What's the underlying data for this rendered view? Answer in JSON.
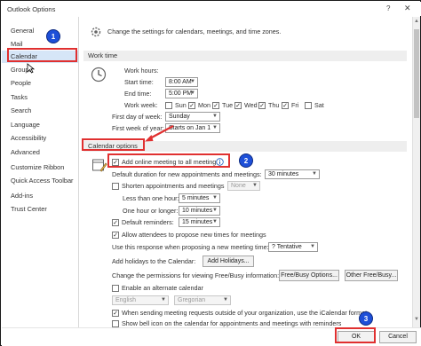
{
  "window": {
    "title": "Outlook Options",
    "help_glyph": "?",
    "close_glyph": "✕"
  },
  "sidebar": {
    "items": [
      {
        "label": "General"
      },
      {
        "label": "Mail"
      },
      {
        "label": "Calendar"
      },
      {
        "label": "Groups"
      },
      {
        "label": "People"
      },
      {
        "label": "Tasks"
      },
      {
        "label": "Search"
      },
      {
        "label": "Language"
      },
      {
        "label": "Accessibility"
      },
      {
        "label": "Advanced"
      },
      {
        "label": "Customize Ribbon"
      },
      {
        "label": "Quick Access Toolbar"
      },
      {
        "label": "Add-ins"
      },
      {
        "label": "Trust Center"
      }
    ],
    "selected": "Calendar"
  },
  "header": {
    "text": "Change the settings for calendars, meetings, and time zones."
  },
  "work_time": {
    "section_title": "Work time",
    "work_hours_label": "Work hours:",
    "start_label": "Start time:",
    "start_value": "8:00 AM",
    "end_label": "End time:",
    "end_value": "5:00 PM",
    "work_week_label": "Work week:",
    "days": [
      {
        "label": "Sun",
        "checked": false
      },
      {
        "label": "Mon",
        "checked": true
      },
      {
        "label": "Tue",
        "checked": true
      },
      {
        "label": "Wed",
        "checked": true
      },
      {
        "label": "Thu",
        "checked": true
      },
      {
        "label": "Fri",
        "checked": true
      },
      {
        "label": "Sat",
        "checked": false
      }
    ],
    "first_day_label": "First day of week:",
    "first_day_value": "Sunday",
    "first_week_label": "First week of year:",
    "first_week_value": "Starts on Jan 1"
  },
  "calendar_options": {
    "section_title": "Calendar options",
    "add_online_meeting": "Add online meeting to all meetings",
    "default_duration_label": "Default duration for new appointments and meetings:",
    "default_duration_value": "30 minutes",
    "shorten_label": "Shorten appointments and meetings",
    "shorten_value": "None",
    "less_than_hour_label": "Less than one hour:",
    "less_than_hour_value": "5 minutes",
    "one_hour_longer_label": "One hour or longer:",
    "one_hour_longer_value": "10 minutes",
    "default_reminders_label": "Default reminders:",
    "default_reminders_value": "15 minutes",
    "allow_propose_label": "Allow attendees to propose new times for meetings",
    "use_response_label": "Use this response when proposing a new meeting time:",
    "use_response_value": "? Tentative",
    "add_holidays_label": "Add holidays to the Calendar:",
    "add_holidays_button": "Add Holidays...",
    "permissions_label": "Change the permissions for viewing Free/Busy information:",
    "free_busy_button": "Free/Busy Options...",
    "other_free_busy_button": "Other Free/Busy...",
    "enable_alt_calendar_label": "Enable an alternate calendar",
    "alt_lang_value": "English",
    "alt_cal_value": "Gregorian",
    "icalendar_label": "When sending meeting requests outside of your organization, use the iCalendar format",
    "bell_icon_label": "Show bell icon on the calendar for appointments and meetings with reminders"
  },
  "footer": {
    "ok_label": "OK",
    "cancel_label": "Cancel"
  },
  "annotations": {
    "step1": "1",
    "step2": "2",
    "step3": "3"
  },
  "colors": {
    "highlight_red": "#e03030",
    "badge_blue": "#1d4fd8",
    "selected_nav": "#d6e6f7"
  }
}
